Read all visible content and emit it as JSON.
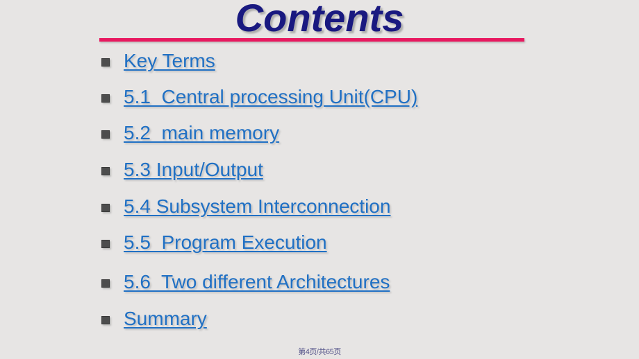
{
  "slide": {
    "title": "Contents",
    "title_color": "#191980",
    "background_color": "#e7e5e4",
    "divider_color": "#e8185f",
    "link_color": "#2070c4",
    "bullet_color": "#4d4d4d"
  },
  "contents": {
    "items": [
      {
        "label": "Key Terms"
      },
      {
        "label": "5.1  Central processing Unit(CPU)"
      },
      {
        "label": "5.2  main memory"
      },
      {
        "label": "5.3 Input/Output"
      },
      {
        "label": "5.4 Subsystem Interconnection"
      },
      {
        "label": "5.5  Program Execution"
      },
      {
        "label": "5.6  Two different Architectures"
      },
      {
        "label": "Summary"
      }
    ]
  },
  "footer": {
    "page_indicator": "第4页/共65页"
  }
}
